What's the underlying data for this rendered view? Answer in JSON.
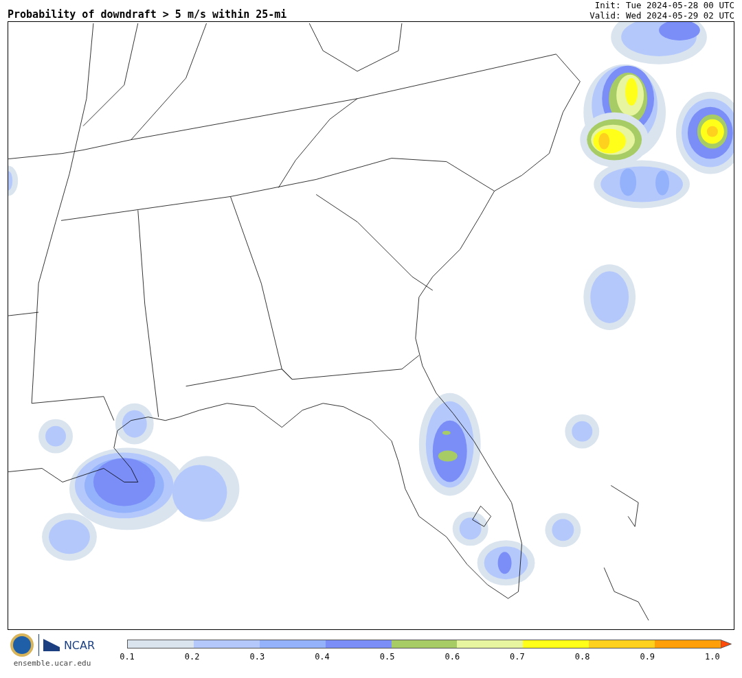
{
  "title": "Probability of downdraft > 5 m/s within 25-mi",
  "init": "Init: Tue 2024-05-28 00 UTC",
  "valid": "Valid: Wed 2024-05-29 02 UTC",
  "logo": {
    "partner": "NCAR",
    "site": "ensemble.ucar.edu"
  },
  "colorbar": {
    "bins": [
      {
        "color": "#dae4ef"
      },
      {
        "color": "#b4c8fc"
      },
      {
        "color": "#94b1fb"
      },
      {
        "color": "#7b8ef8"
      },
      {
        "color": "#a7cc66"
      },
      {
        "color": "#e8f5a0"
      },
      {
        "color": "#ffff1a"
      },
      {
        "color": "#ffd11f"
      },
      {
        "color": "#ff9f0a"
      }
    ],
    "extend": {
      "color": "#ff4b0a"
    },
    "ticks": [
      "0.1",
      "0.2",
      "0.3",
      "0.4",
      "0.5",
      "0.6",
      "0.7",
      "0.8",
      "0.9",
      "1.0"
    ]
  }
}
